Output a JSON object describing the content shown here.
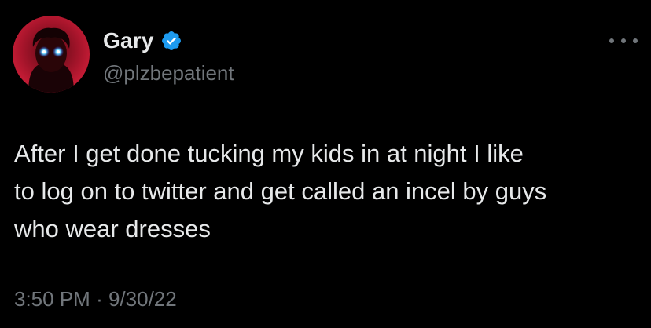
{
  "tweet": {
    "author": {
      "display_name": "Gary",
      "handle": "@plzbepatient",
      "verified": true,
      "avatar_icon": "avatar-glowing-eyes"
    },
    "text_lines": [
      "After I get done tucking my kids in at night I like",
      "to log on to twitter and get called an incel by guys",
      "who wear dresses"
    ],
    "time": "3:50 PM",
    "separator": "·",
    "date": "9/30/22",
    "more_icon": "more-horizontal-icon"
  },
  "colors": {
    "background": "#000000",
    "primary_text": "#e7e9ea",
    "secondary_text": "#71767b",
    "verified_blue": "#1d9bf0"
  }
}
